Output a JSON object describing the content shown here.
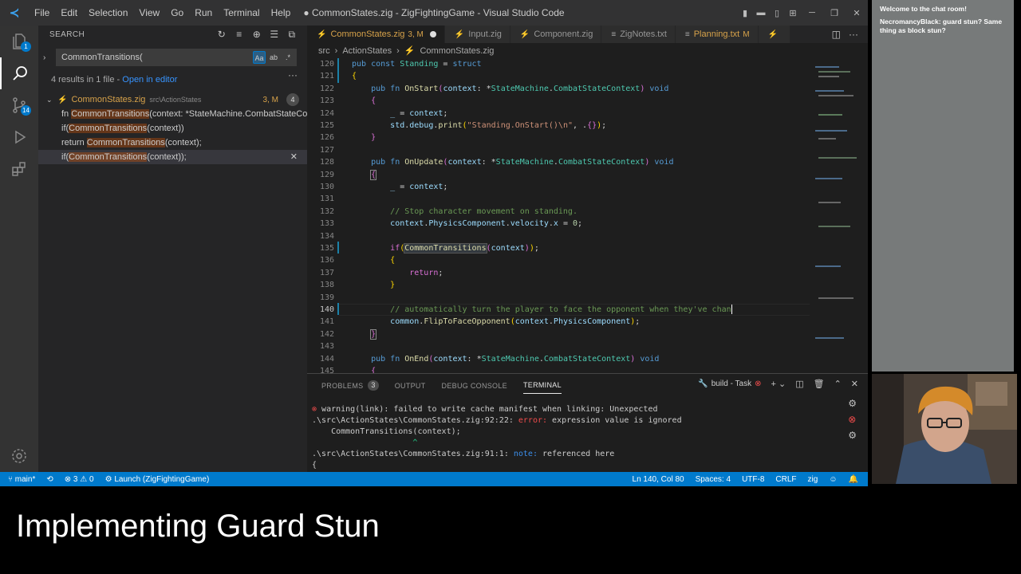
{
  "window": {
    "title": "● CommonStates.zig - ZigFightingGame - Visual Studio Code",
    "menu": [
      "File",
      "Edit",
      "Selection",
      "View",
      "Go",
      "Run",
      "Terminal",
      "Help"
    ]
  },
  "activity_bar": {
    "explorer_badge": "1",
    "scm_badge": "14"
  },
  "sidebar": {
    "header": "SEARCH",
    "search_value": "CommonTransitions(",
    "option_case": "Aa",
    "option_word": "ab",
    "option_regex": ".*",
    "summary_text": "4 results in 1 file - ",
    "summary_link": "Open in editor",
    "file": {
      "name": "CommonStates.zig",
      "path": "src\\ActionStates",
      "status": "3, M",
      "count": "4"
    },
    "matches": [
      {
        "pre": "fn ",
        "hit": "CommonTransitions",
        "post": "(context: *StateMachine.CombatStateCont..."
      },
      {
        "pre": "if(",
        "hit": "CommonTransitions",
        "post": "(context))"
      },
      {
        "pre": "return ",
        "hit": "CommonTransitions",
        "post": "(context);"
      },
      {
        "pre": "if(",
        "hit": "CommonTransitions",
        "post": "(context));"
      }
    ]
  },
  "editor": {
    "tabs": [
      {
        "label": "CommonStates.zig",
        "mod": "3, M",
        "active": true
      },
      {
        "label": "Input.zig",
        "mod": "",
        "active": false
      },
      {
        "label": "Component.zig",
        "mod": "",
        "active": false
      },
      {
        "label": "ZigNotes.txt",
        "mod": "",
        "active": false
      },
      {
        "label": "Planning.txt",
        "mod": "M",
        "active": false
      }
    ],
    "breadcrumb": [
      "src",
      "ActionStates",
      "CommonStates.zig"
    ],
    "line_numbers": [
      "120",
      "121",
      "122",
      "123",
      "124",
      "125",
      "126",
      "127",
      "128",
      "129",
      "130",
      "131",
      "132",
      "133",
      "134",
      "135",
      "136",
      "137",
      "138",
      "139",
      "140",
      "141",
      "142",
      "143",
      "144",
      "145"
    ],
    "current_line": "140"
  },
  "panel": {
    "tabs": {
      "problems": "PROBLEMS",
      "problems_count": "3",
      "output": "OUTPUT",
      "debug": "DEBUG CONSOLE",
      "terminal": "TERMINAL"
    },
    "task_label": "build - Task",
    "terminal_lines": [
      "warning(link): failed to write cache manifest when linking: Unexpected",
      ".\\src\\ActionStates\\CommonStates.zig:92:22: ",
      "error: ",
      "expression value is ignored",
      "    CommonTransitions(context);",
      "                     ^",
      ".\\src\\ActionStates\\CommonStates.zig:91:1: ",
      "note: ",
      "referenced here",
      "{"
    ]
  },
  "statusbar": {
    "branch": "main*",
    "errors": "3",
    "warnings": "0",
    "launch": "Launch (ZigFightingGame)",
    "position": "Ln 140, Col 80",
    "spaces": "Spaces: 4",
    "encoding": "UTF-8",
    "eol": "CRLF",
    "language": "zig"
  },
  "chat": {
    "welcome": "Welcome to the chat room!",
    "user": "NecromancyBlack:",
    "message": " guard stun? Same thing as block stun?"
  },
  "caption": "Implementing Guard Stun",
  "colors": {
    "accent": "#007acc",
    "editor_bg": "#1e1e1e",
    "sidebar_bg": "#252526"
  }
}
